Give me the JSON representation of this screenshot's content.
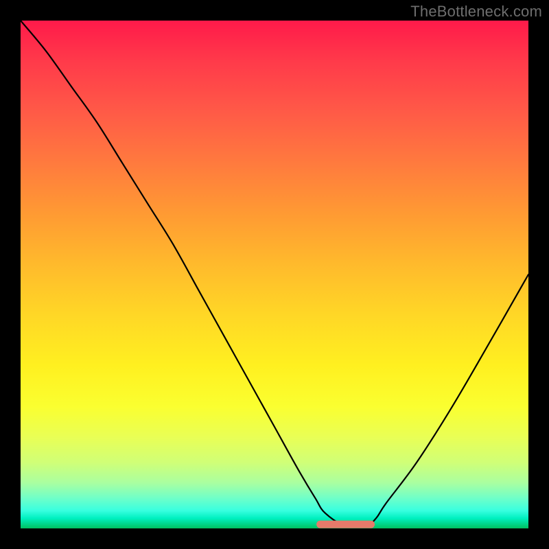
{
  "watermark": "TheBottleneck.com",
  "chart_data": {
    "type": "line",
    "title": "",
    "xlabel": "",
    "ylabel": "",
    "xlim": [
      0,
      100
    ],
    "ylim": [
      0,
      100
    ],
    "background": "rainbow-gradient",
    "series": [
      {
        "name": "curve",
        "x": [
          0,
          5,
          10,
          15,
          20,
          25,
          30,
          35,
          40,
          45,
          50,
          55,
          58,
          60,
          64,
          68,
          70,
          72,
          78,
          85,
          92,
          100
        ],
        "y": [
          100,
          94,
          87,
          80,
          72,
          64,
          56,
          47,
          38,
          29,
          20,
          11,
          6,
          3,
          0.5,
          0.5,
          2,
          5,
          13,
          24,
          36,
          50
        ]
      }
    ],
    "annotations": [
      {
        "name": "bottom-marker",
        "type": "segment",
        "x0": 59,
        "x1": 69,
        "y": 0.8,
        "color": "#e67a6a"
      }
    ]
  }
}
